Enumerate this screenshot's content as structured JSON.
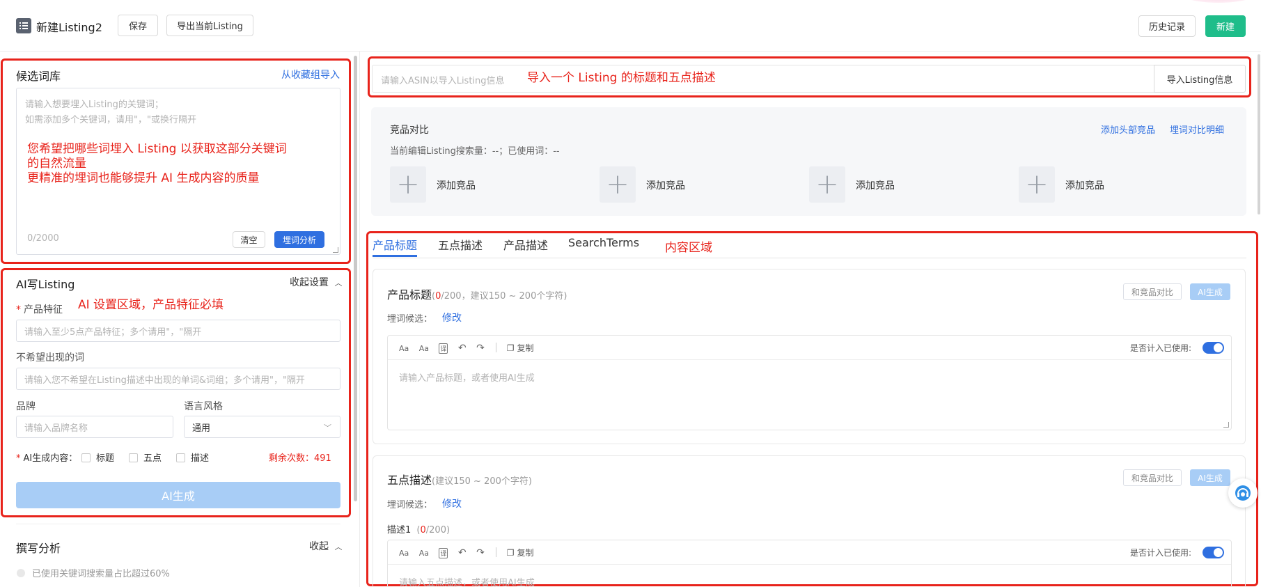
{
  "header": {
    "title": "新建Listing2",
    "save_label": "保存",
    "export_label": "导出当前Listing",
    "history_label": "历史记录",
    "new_label": "新建"
  },
  "candidate": {
    "title": "候选词库",
    "import_link": "从收藏组导入",
    "placeholder_line1": "请输入想要埋入Listing的关键词；",
    "placeholder_line2": "如需添加多个关键词，请用\"，\"或换行隔开",
    "annotation_line1": "您希望把哪些词埋入 Listing 以获取这部分关键词",
    "annotation_line2": "的自然流量",
    "annotation_line3": "更精准的埋词也能够提升 AI 生成内容的质量",
    "counter": "0/2000",
    "clear_label": "清空",
    "analyze_label": "埋词分析"
  },
  "ai": {
    "title": "AI写Listing",
    "collapse_label": "收起设置",
    "annotation": "AI 设置区域，产品特征必填",
    "feature_label": "产品特征",
    "feature_placeholder": "请输入至少5点产品特征；多个请用\"，\"隔开",
    "unwanted_label": "不希望出现的词",
    "unwanted_placeholder": "请输入您不希望在Listing描述中出现的单词&词组；多个请用\"，\"隔开",
    "brand_label": "品牌",
    "brand_placeholder": "请输入品牌名称",
    "style_label": "语言风格",
    "style_value": "通用",
    "content_label": "AI生成内容：",
    "opt_title": "标题",
    "opt_bullets": "五点",
    "opt_desc": "描述",
    "remaining": "剩余次数：491",
    "generate_label": "AI生成"
  },
  "analysis": {
    "title": "撰写分析",
    "collapse_label": "收起",
    "item1": "已使用关键词搜索量占比超过60%"
  },
  "asin": {
    "placeholder": "请输入ASIN以导入Listing信息",
    "annotation": "导入一个 Listing 的标题和五点描述",
    "import_label": "导入Listing信息"
  },
  "compare": {
    "title": "竞品对比",
    "add_top_link": "添加头部竞品",
    "detail_link": "埋词对比明细",
    "info": "当前编辑Listing搜索量：--；已使用词：--",
    "slots": [
      "添加竞品",
      "添加竞品",
      "添加竞品",
      "添加竞品"
    ]
  },
  "tabs": {
    "items": [
      "产品标题",
      "五点描述",
      "产品描述",
      "SearchTerms"
    ],
    "annotation": "内容区域"
  },
  "title_card": {
    "title": "产品标题",
    "count_open": "(",
    "count_red": "0",
    "count_rest": "/200，建议150 ~ 200个字符)",
    "compare_label": "和竞品对比",
    "ai_label": "AI生成",
    "candidate_label": "埋词候选：",
    "edit_link": "修改",
    "copy_label": "复制",
    "count_used_label": "是否计入已使用:",
    "placeholder": "请输入产品标题，或者使用AI生成"
  },
  "bullets_card": {
    "title": "五点描述",
    "hint": "(建议150 ~ 200个字符)",
    "compare_label": "和竞品对比",
    "ai_label": "AI生成",
    "candidate_label": "埋词候选：",
    "edit_link": "修改",
    "desc1_label": "描述1",
    "desc1_open": "(",
    "desc1_red": "0",
    "desc1_rest": "/200)",
    "copy_label": "复制",
    "count_used_label": "是否计入已使用:",
    "placeholder": "请输入五点描述，或者使用AI生成"
  },
  "colors": {
    "accent": "#2f6fe0",
    "brand_green": "#1fbd8a",
    "annotation_red": "#e8231b",
    "ai_disabled": "#a8cdf6"
  }
}
